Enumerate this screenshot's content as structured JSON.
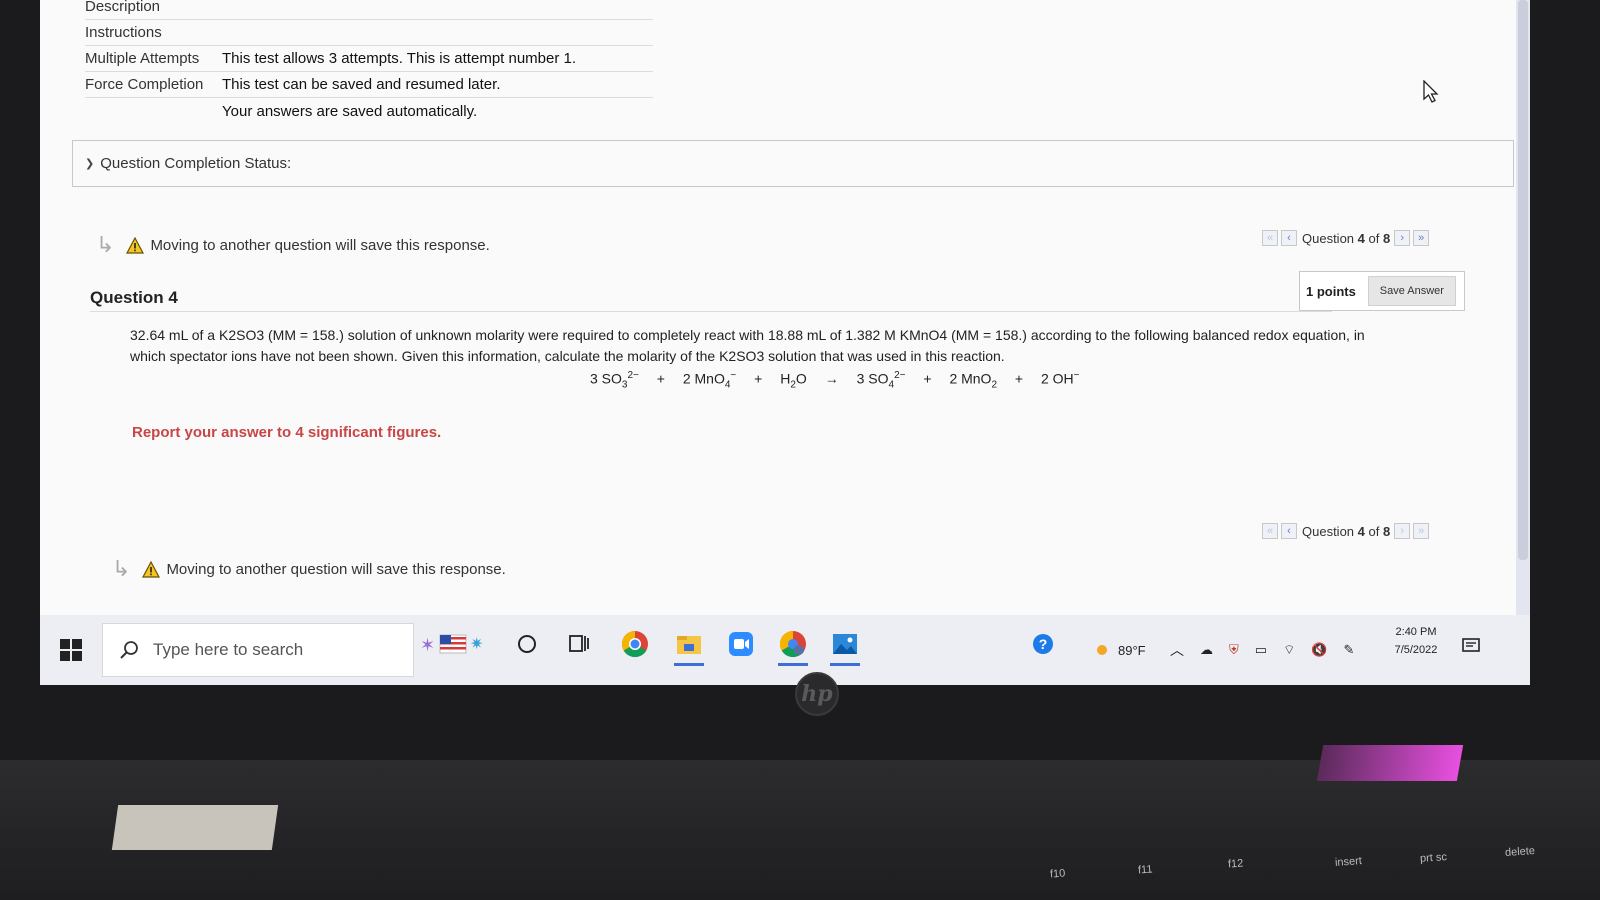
{
  "info": {
    "rows": [
      {
        "label": "Description",
        "value": ""
      },
      {
        "label": "Instructions",
        "value": ""
      },
      {
        "label": "Multiple Attempts",
        "value": "This test allows 3 attempts. This is attempt number 1."
      },
      {
        "label": "Force Completion",
        "value": "This test can be saved and resumed later."
      },
      {
        "label": "",
        "value": "Your answers are saved automatically."
      }
    ]
  },
  "status": {
    "label": "Question Completion Status:"
  },
  "warning": {
    "text": "Moving to another question will save this response."
  },
  "qnav": {
    "prefix": "Question",
    "current": "4",
    "sep": "of",
    "total": "8"
  },
  "question": {
    "title": "Question 4",
    "points": "1 points",
    "save_label": "Save Answer",
    "text_line1": "32.64 mL of a K2SO3 (MM = 158.) solution of unknown molarity were required to completely react with 18.88 mL of 1.382 M KMnO4 (MM = 158.) according to the following balanced redox equation, in",
    "text_line2": "which spectator ions have not been shown.  Given this information, calculate the molarity of the K2SO3 solution that was used in this reaction.",
    "equation": {
      "t1": "3 SO",
      "t1sub": "3",
      "t1sup": "2−",
      "plus1": "+",
      "t2": "2 MnO",
      "t2sub": "4",
      "t2sup": "−",
      "plus2": "+",
      "t3": "H",
      "t3sub": "2",
      "t3b": "O",
      "arrow": "→",
      "t4": "3 SO",
      "t4sub": "4",
      "t4sup": "2−",
      "plus3": "+",
      "t5": "2 MnO",
      "t5sub": "2",
      "plus4": "+",
      "t6": "2 OH",
      "t6sup": "−"
    },
    "instruction": "Report your answer to 4 significant figures."
  },
  "taskbar": {
    "search_placeholder": "Type here to search",
    "weather": "89°F",
    "time": "2:40 PM",
    "date": "7/5/2022"
  },
  "keyboard": {
    "keys": [
      "f10",
      "f11",
      "f12",
      "insert",
      "prt sc",
      "delete"
    ]
  },
  "colors": {
    "accent": "#3d6fd6",
    "warning": "#c84646"
  }
}
